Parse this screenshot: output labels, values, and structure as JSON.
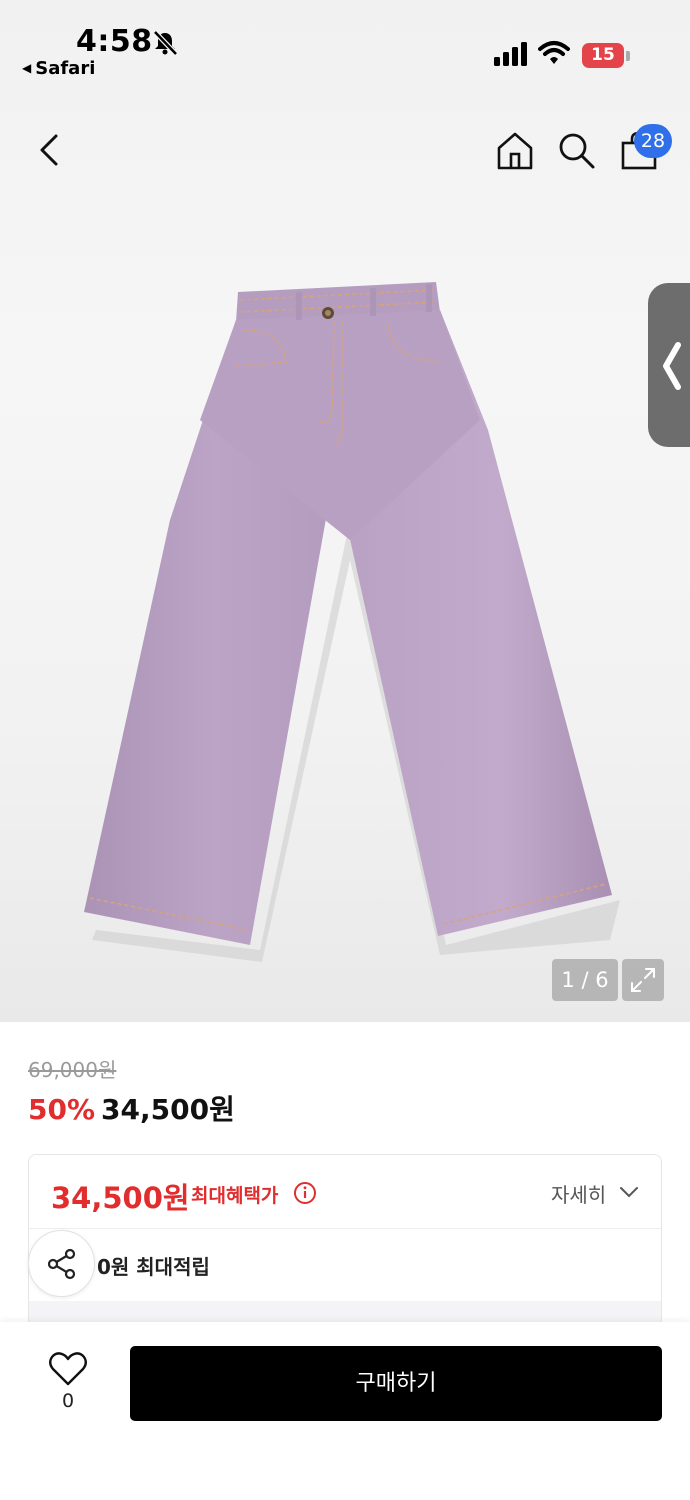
{
  "status_bar": {
    "time": "4:58",
    "back_app": "Safari",
    "battery": "15"
  },
  "nav": {
    "cart_count": "28"
  },
  "gallery": {
    "counter": "1 / 6"
  },
  "product": {
    "original_price": "69,000원",
    "discount_rate": "50%",
    "sale_price": "34,500원"
  },
  "benefit": {
    "max_price": "34,500원",
    "max_label": "최대혜택가",
    "detail_label": "자세히",
    "points_text": "0원 최대적립"
  },
  "bottom": {
    "like_count": "0",
    "buy_label": "구매하기"
  },
  "colors": {
    "accent_red": "#e12d2d",
    "badge_blue": "#2f6fe9",
    "pants_lavender": "#b9a1c2"
  },
  "icons": [
    "bell-off-icon",
    "signal-icon",
    "wifi-icon",
    "back-arrow-icon",
    "home-icon",
    "search-icon",
    "cart-icon",
    "chevron-left-icon",
    "expand-icon",
    "info-icon",
    "chevron-down-icon",
    "share-icon",
    "heart-icon"
  ]
}
